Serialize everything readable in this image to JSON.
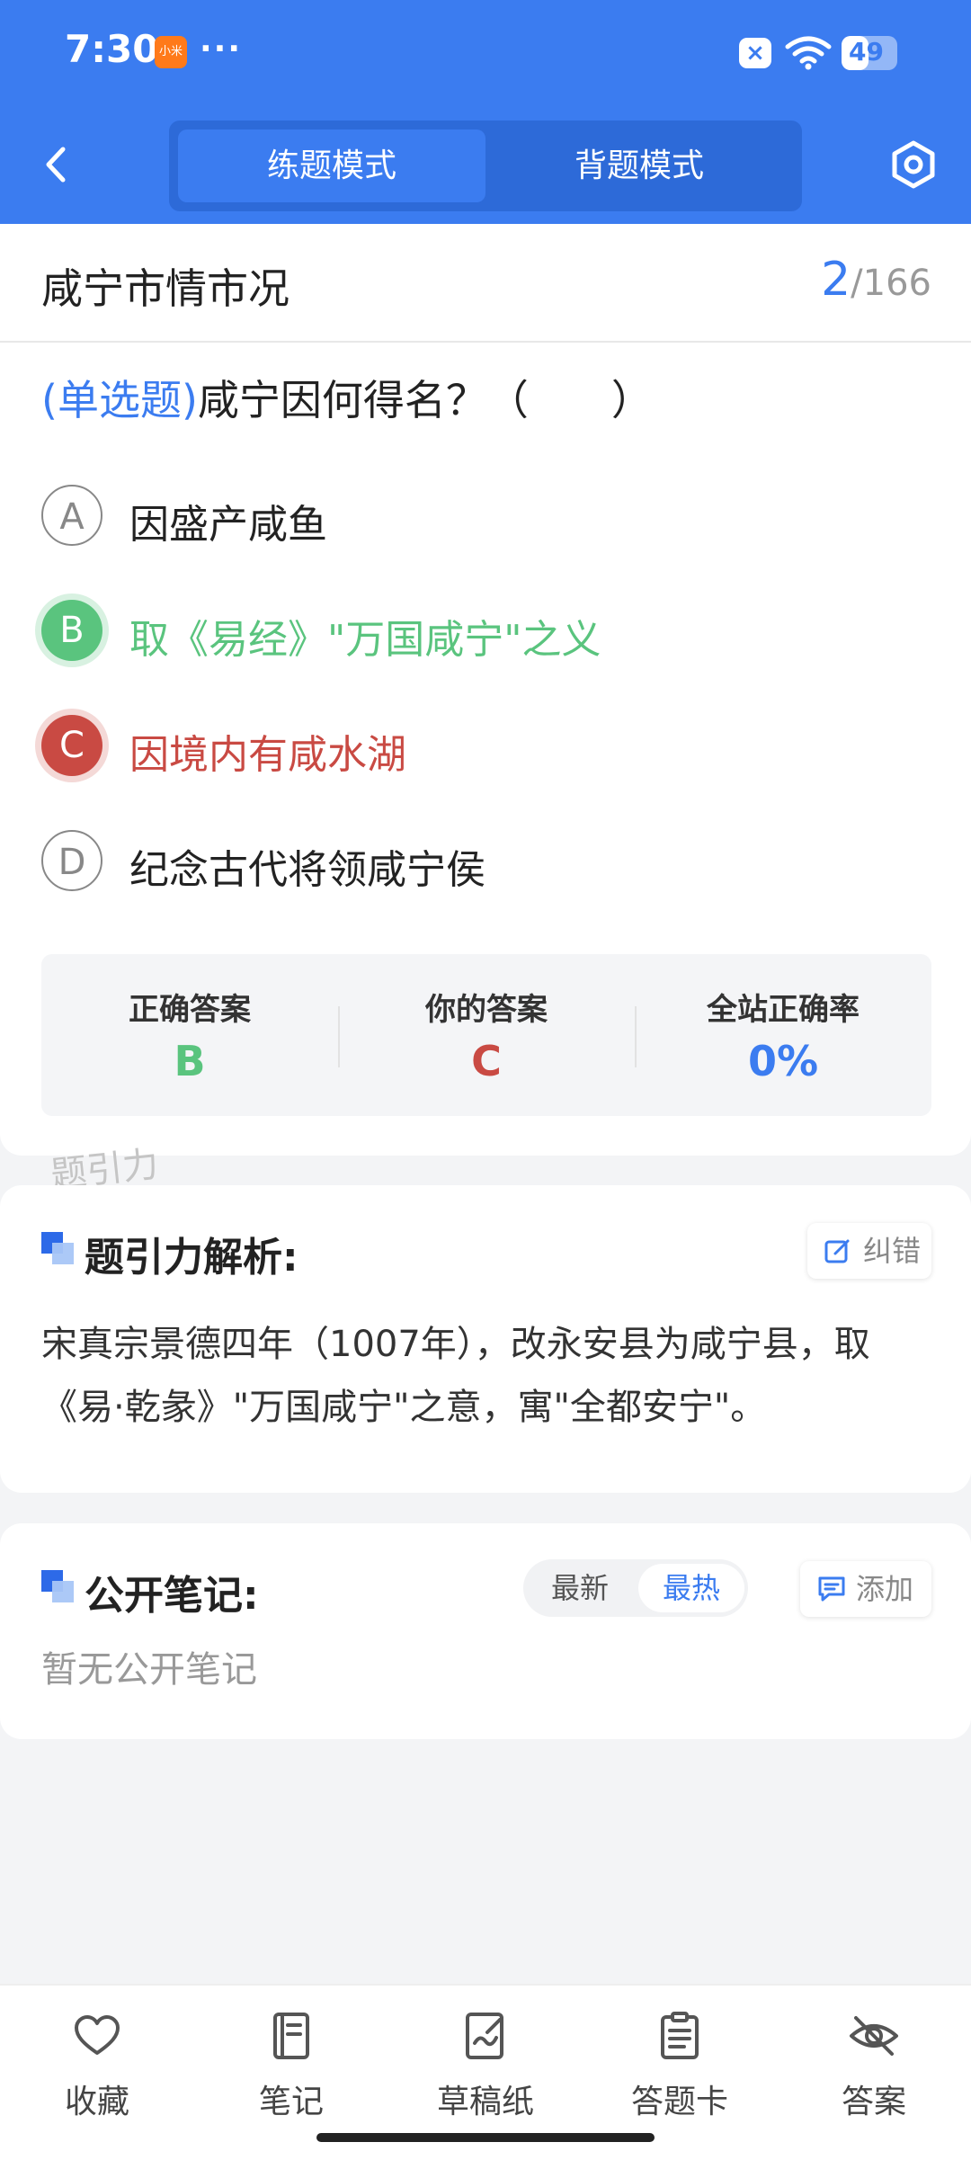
{
  "status_bar": {
    "time": "7:30",
    "app_icon": "小米",
    "overflow": "···",
    "battery_level": "49",
    "battery_fraction": 0.49,
    "icons": [
      "xiaomi-app-icon",
      "close-notification-icon",
      "wifi-icon",
      "battery-icon"
    ]
  },
  "header": {
    "tabs": [
      {
        "label": "练题模式",
        "active": true
      },
      {
        "label": "背题模式",
        "active": false
      }
    ]
  },
  "question": {
    "category": "咸宁市情市况",
    "current": "2",
    "total": "/166",
    "type_tag": "(单选题)",
    "title": "咸宁因何得名？（　　）",
    "options": [
      {
        "letter": "A",
        "text": "因盛产咸鱼",
        "state": "normal"
      },
      {
        "letter": "B",
        "text": "取《易经》\"万国咸宁\"之义",
        "state": "correct"
      },
      {
        "letter": "C",
        "text": "因境内有咸水湖",
        "state": "wrong"
      },
      {
        "letter": "D",
        "text": "纪念古代将领咸宁侯",
        "state": "normal"
      }
    ],
    "stats": [
      {
        "label": "正确答案",
        "value": "B",
        "color": "#5ac47e"
      },
      {
        "label": "你的答案",
        "value": "C",
        "color": "#c94a43"
      },
      {
        "label": "全站正确率",
        "value": "0%",
        "color": "#3b7cf0"
      }
    ],
    "watermark": "题引力"
  },
  "analysis": {
    "title": "题引力解析:",
    "report_label": "纠错",
    "text": "宋真宗景德四年（1007年），改永安县为咸宁县，取《易·乾彖》\"万国咸宁\"之意，寓\"全都安宁\"。"
  },
  "notes": {
    "title": "公开笔记:",
    "sort_options": [
      {
        "label": "最新",
        "active": false
      },
      {
        "label": "最热",
        "active": true
      }
    ],
    "add_label": "添加",
    "empty_text": "暂无公开笔记"
  },
  "bottom_bar": {
    "items": [
      {
        "label": "收藏",
        "icon": "heart-icon"
      },
      {
        "label": "笔记",
        "icon": "notebook-icon"
      },
      {
        "label": "草稿纸",
        "icon": "draft-paper-icon"
      },
      {
        "label": "答题卡",
        "icon": "answer-card-icon"
      },
      {
        "label": "答案",
        "icon": "eye-off-icon"
      }
    ]
  },
  "colors": {
    "primary": "#3b7cf0",
    "correct": "#5ac47e",
    "wrong": "#c94a43",
    "background": "#f3f4f6"
  }
}
